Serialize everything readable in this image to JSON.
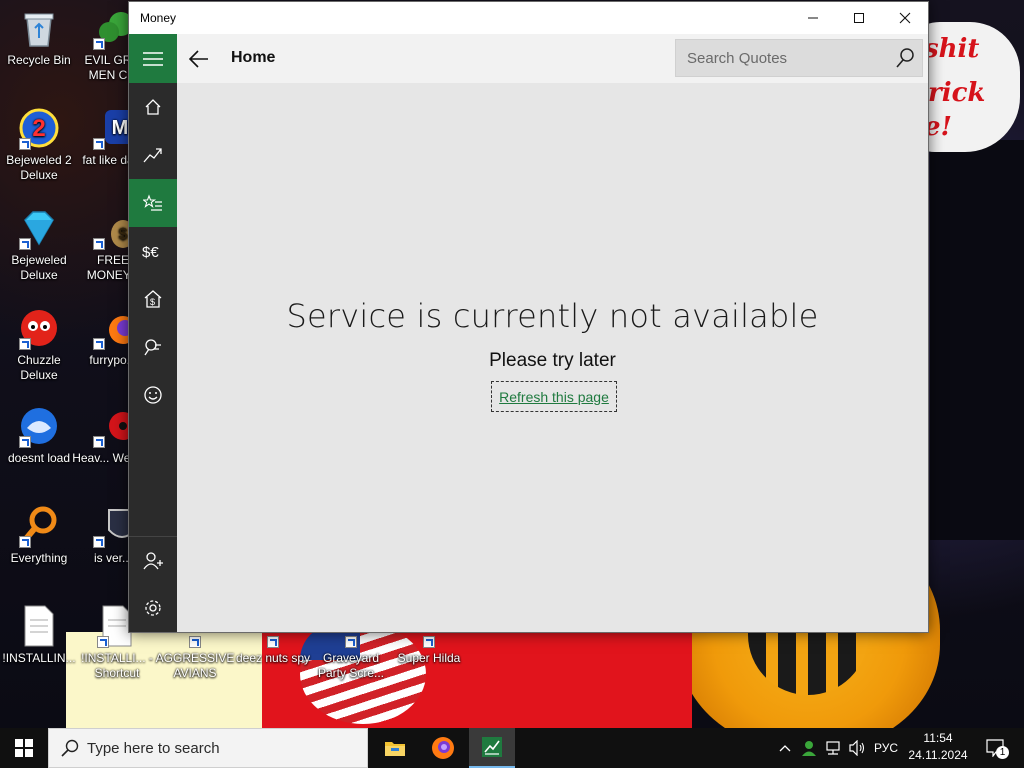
{
  "window": {
    "title": "Money",
    "page_title": "Home",
    "search_placeholder": "Search Quotes",
    "error_title": "Service is currently not available",
    "error_subtitle": "Please try later",
    "refresh_label": "Refresh this page",
    "nav_items": [
      {
        "name": "nav-home-icon",
        "icon": "home-icon"
      },
      {
        "name": "nav-markets-icon",
        "icon": "trend-up-icon"
      },
      {
        "name": "nav-watchlist-icon",
        "icon": "star-list-icon",
        "active": true
      },
      {
        "name": "nav-currencies-icon",
        "icon": "currency-icon"
      },
      {
        "name": "nav-mortgage-icon",
        "icon": "house-dollar-icon"
      },
      {
        "name": "nav-news-icon",
        "icon": "news-icon"
      },
      {
        "name": "nav-feedback-icon",
        "icon": "smiley-icon"
      }
    ],
    "accent_color": "#1f7a3f"
  },
  "desktop": {
    "wallpaper_text": [
      "shit",
      "rick",
      "e!"
    ],
    "icons": [
      {
        "label": "Recycle Bin"
      },
      {
        "label": "EVIL GR... MEN C..."
      },
      {
        "label": "Bejeweled 2 Deluxe"
      },
      {
        "label": "fat like da..."
      },
      {
        "label": "Bejeweled Deluxe"
      },
      {
        "label": "FREE MONEY..."
      },
      {
        "label": "Chuzzle Deluxe"
      },
      {
        "label": "furrypo..."
      },
      {
        "label": "doesnt load"
      },
      {
        "label": "Heav... Weap..."
      },
      {
        "label": "Everything"
      },
      {
        "label": "is ver..."
      },
      {
        "label": "!INSTALLIN..."
      },
      {
        "label": "!INSTALLI... - Shortcut"
      },
      {
        "label": "AGGRESSIVE AVIANS"
      },
      {
        "label": "deez nuts spy"
      },
      {
        "label": "Graveyard Party Scre..."
      },
      {
        "label": "Super Hilda"
      }
    ]
  },
  "taskbar": {
    "search_placeholder": "Type here to search",
    "language": "РУС",
    "time": "11:54",
    "date": "24.11.2024",
    "notifications": "1"
  }
}
